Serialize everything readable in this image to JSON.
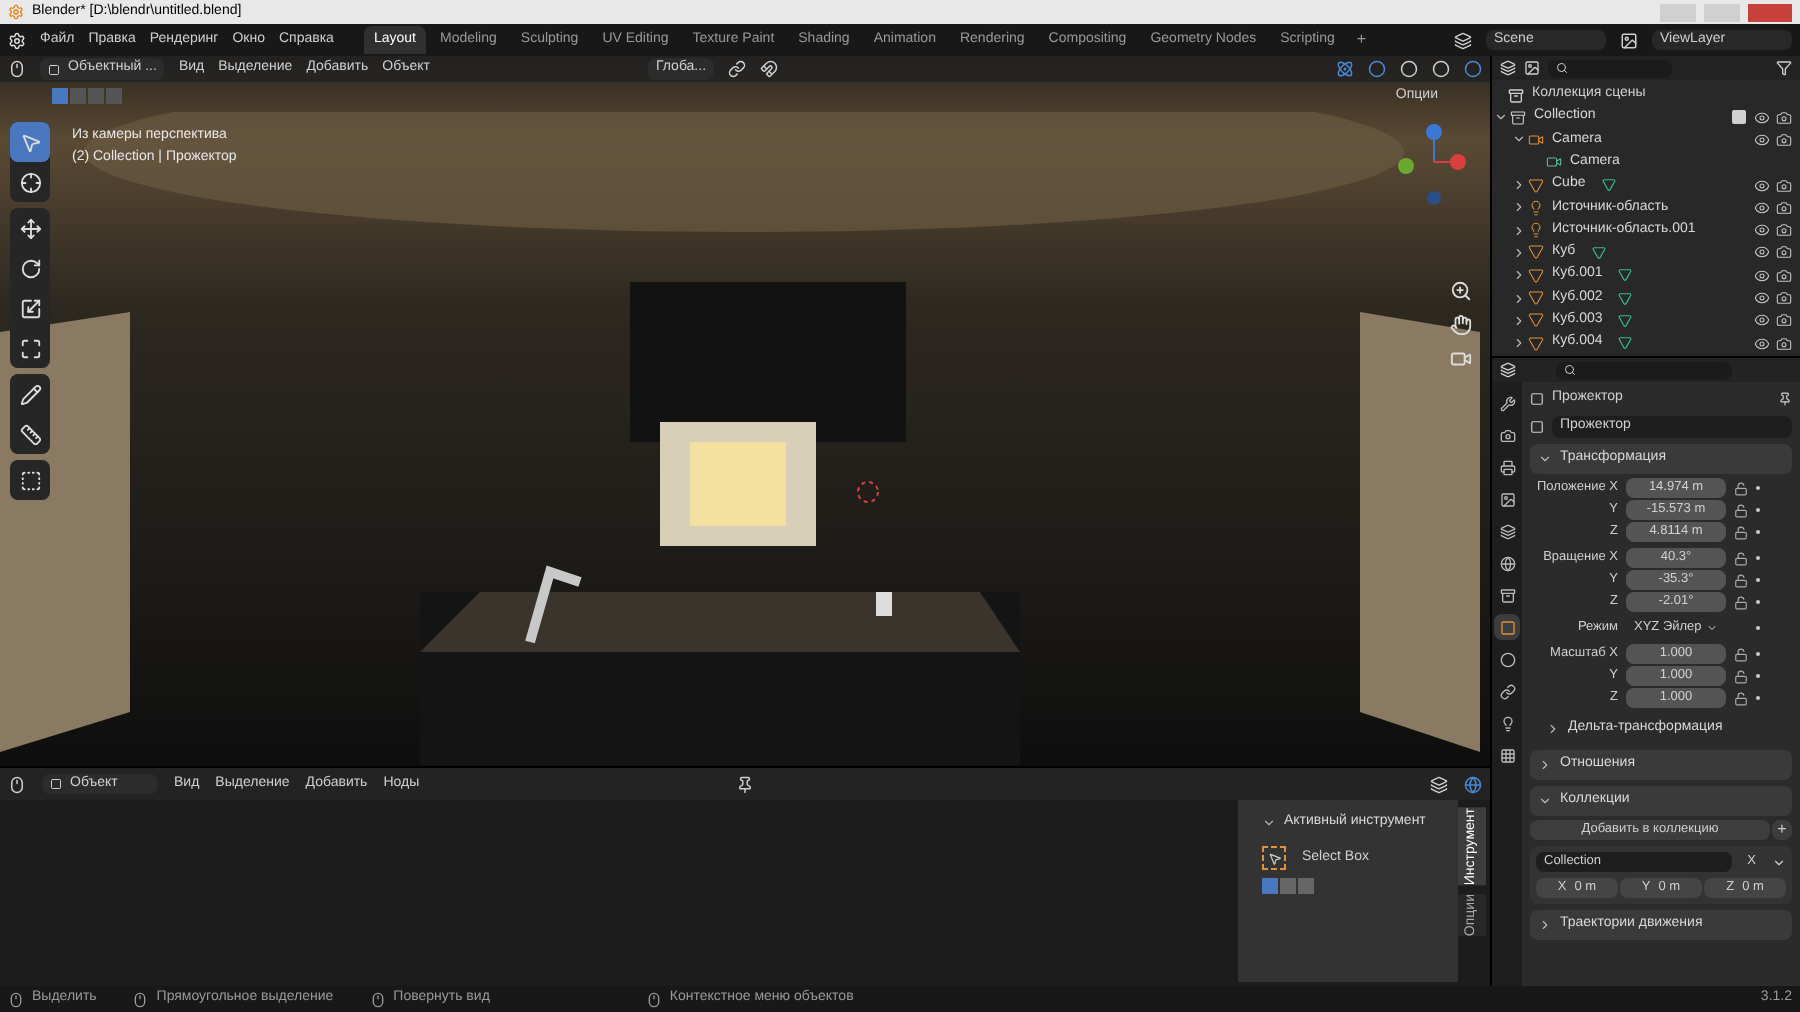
{
  "title_bar": {
    "title": "Blender* [D:\\blendr\\untitled.blend]"
  },
  "menu_bar": {
    "menus": [
      "Файл",
      "Правка",
      "Рендеринг",
      "Окно",
      "Справка"
    ],
    "workspaces": [
      {
        "label": "Layout",
        "selected": true
      },
      {
        "label": "Modeling",
        "selected": false
      },
      {
        "label": "Sculpting",
        "selected": false
      },
      {
        "label": "UV Editing",
        "selected": false
      },
      {
        "label": "Texture Paint",
        "selected": false
      },
      {
        "label": "Shading",
        "selected": false
      },
      {
        "label": "Animation",
        "selected": false
      },
      {
        "label": "Rendering",
        "selected": false
      },
      {
        "label": "Compositing",
        "selected": false
      },
      {
        "label": "Geometry Nodes",
        "selected": false
      },
      {
        "label": "Scripting",
        "selected": false
      }
    ],
    "add_tab": "+",
    "scene": "Scene",
    "view_layer": "ViewLayer"
  },
  "viewport": {
    "header": {
      "mode": "Объектный ...",
      "menus": [
        "Вид",
        "Выделение",
        "Добавить",
        "Объект"
      ],
      "orientation": "Глоба...",
      "options": "Опции"
    },
    "overlay_lines": [
      "Из камеры перспектива",
      "(2) Collection | Прожектор"
    ],
    "tool_groups": [
      [
        {
          "kind": "select",
          "selected": true
        },
        {
          "kind": "cursor",
          "selected": false
        }
      ],
      [
        {
          "kind": "move",
          "selected": false
        },
        {
          "kind": "rotate",
          "selected": false
        },
        {
          "kind": "scale",
          "selected": false
        },
        {
          "kind": "transform",
          "selected": false
        }
      ],
      [
        {
          "kind": "annotate",
          "selected": false
        },
        {
          "kind": "measure",
          "selected": false
        }
      ],
      [
        {
          "kind": "add_cube",
          "selected": false
        }
      ]
    ]
  },
  "outliner": {
    "root": "Коллекция сцены",
    "items": [
      {
        "name": "Collection",
        "kind": "collection",
        "expanded": true,
        "checked": true,
        "children": [
          {
            "name": "Camera",
            "kind": "camera",
            "expanded": true,
            "children": [
              {
                "name": "Camera",
                "kind": "camera_data"
              }
            ]
          },
          {
            "name": "Cube",
            "kind": "mesh",
            "expanded": false
          },
          {
            "name": "Источник-область",
            "kind": "light",
            "expanded": false
          },
          {
            "name": "Источник-область.001",
            "kind": "light",
            "expanded": false
          },
          {
            "name": "Куб",
            "kind": "mesh",
            "expanded": false
          },
          {
            "name": "Куб.001",
            "kind": "mesh",
            "expanded": false
          },
          {
            "name": "Куб.002",
            "kind": "mesh",
            "expanded": false
          },
          {
            "name": "Куб.003",
            "kind": "mesh",
            "expanded": false
          },
          {
            "name": "Куб.004",
            "kind": "mesh",
            "expanded": false
          }
        ]
      }
    ]
  },
  "properties": {
    "tabs": [
      {
        "kind": "tool",
        "selected": false
      },
      {
        "kind": "render",
        "selected": false
      },
      {
        "kind": "output",
        "selected": false
      },
      {
        "kind": "view_layer",
        "selected": false
      },
      {
        "kind": "scene",
        "selected": false
      },
      {
        "kind": "world",
        "selected": false
      },
      {
        "kind": "collection",
        "selected": false
      },
      {
        "kind": "object",
        "selected": true
      },
      {
        "kind": "physics",
        "selected": false
      },
      {
        "kind": "constraints",
        "selected": false
      },
      {
        "kind": "data",
        "selected": false
      },
      {
        "kind": "texture",
        "selected": false
      }
    ],
    "object_name": "Прожектор",
    "data_name": "Прожектор",
    "panels": [
      {
        "kind": "transform",
        "title": "Трансформация",
        "expanded": true,
        "groups": [
          [
            {
              "label": "Положение X",
              "value": "14.974 m"
            },
            {
              "label": "Y",
              "value": "-15.573 m"
            },
            {
              "label": "Z",
              "value": "4.8114 m"
            }
          ],
          [
            {
              "label": "Вращение X",
              "value": "40.3°"
            },
            {
              "label": "Y",
              "value": "-35.3°"
            },
            {
              "label": "Z",
              "value": "-2.01°"
            }
          ],
          [
            {
              "label": "Режим",
              "value": "XYZ Эйлер",
              "kind": "enum"
            }
          ],
          [
            {
              "label": "Масштаб X",
              "value": "1.000"
            },
            {
              "label": "Y",
              "value": "1.000"
            },
            {
              "label": "Z",
              "value": "1.000"
            }
          ]
        ],
        "subpanel": {
          "title": "Дельта-трансформация",
          "expanded": false
        }
      },
      {
        "title": "Отношения",
        "expanded": false
      },
      {
        "kind": "collections",
        "title": "Коллекции",
        "expanded": true,
        "add_button": "Добавить в коллекцию",
        "add_icon": "+",
        "collection": "Collection",
        "remove": "X",
        "offset": [
          {
            "axis": "X",
            "value": "0 m"
          },
          {
            "axis": "Y",
            "value": "0 m"
          },
          {
            "axis": "Z",
            "value": "0 m"
          }
        ]
      },
      {
        "title": "Траектории движения",
        "expanded": false
      }
    ]
  },
  "node_editor": {
    "mode": "Объект",
    "menus": [
      "Вид",
      "Выделение",
      "Добавить",
      "Ноды"
    ],
    "sidebar": {
      "panel_title": "Активный инструмент",
      "expanded": true,
      "tool": "Select Box",
      "modes": [
        {
          "selected": true
        },
        {
          "selected": false
        },
        {
          "selected": false
        }
      ],
      "tabs": [
        {
          "label": "Инструмент",
          "selected": true
        },
        {
          "label": "Опции",
          "selected": false
        }
      ]
    }
  },
  "status_bar": {
    "hints": [
      "Выделить",
      "Прямоугольное выделение",
      "Повернуть вид",
      "Контекстное меню объектов"
    ],
    "version": "3.1.2"
  }
}
